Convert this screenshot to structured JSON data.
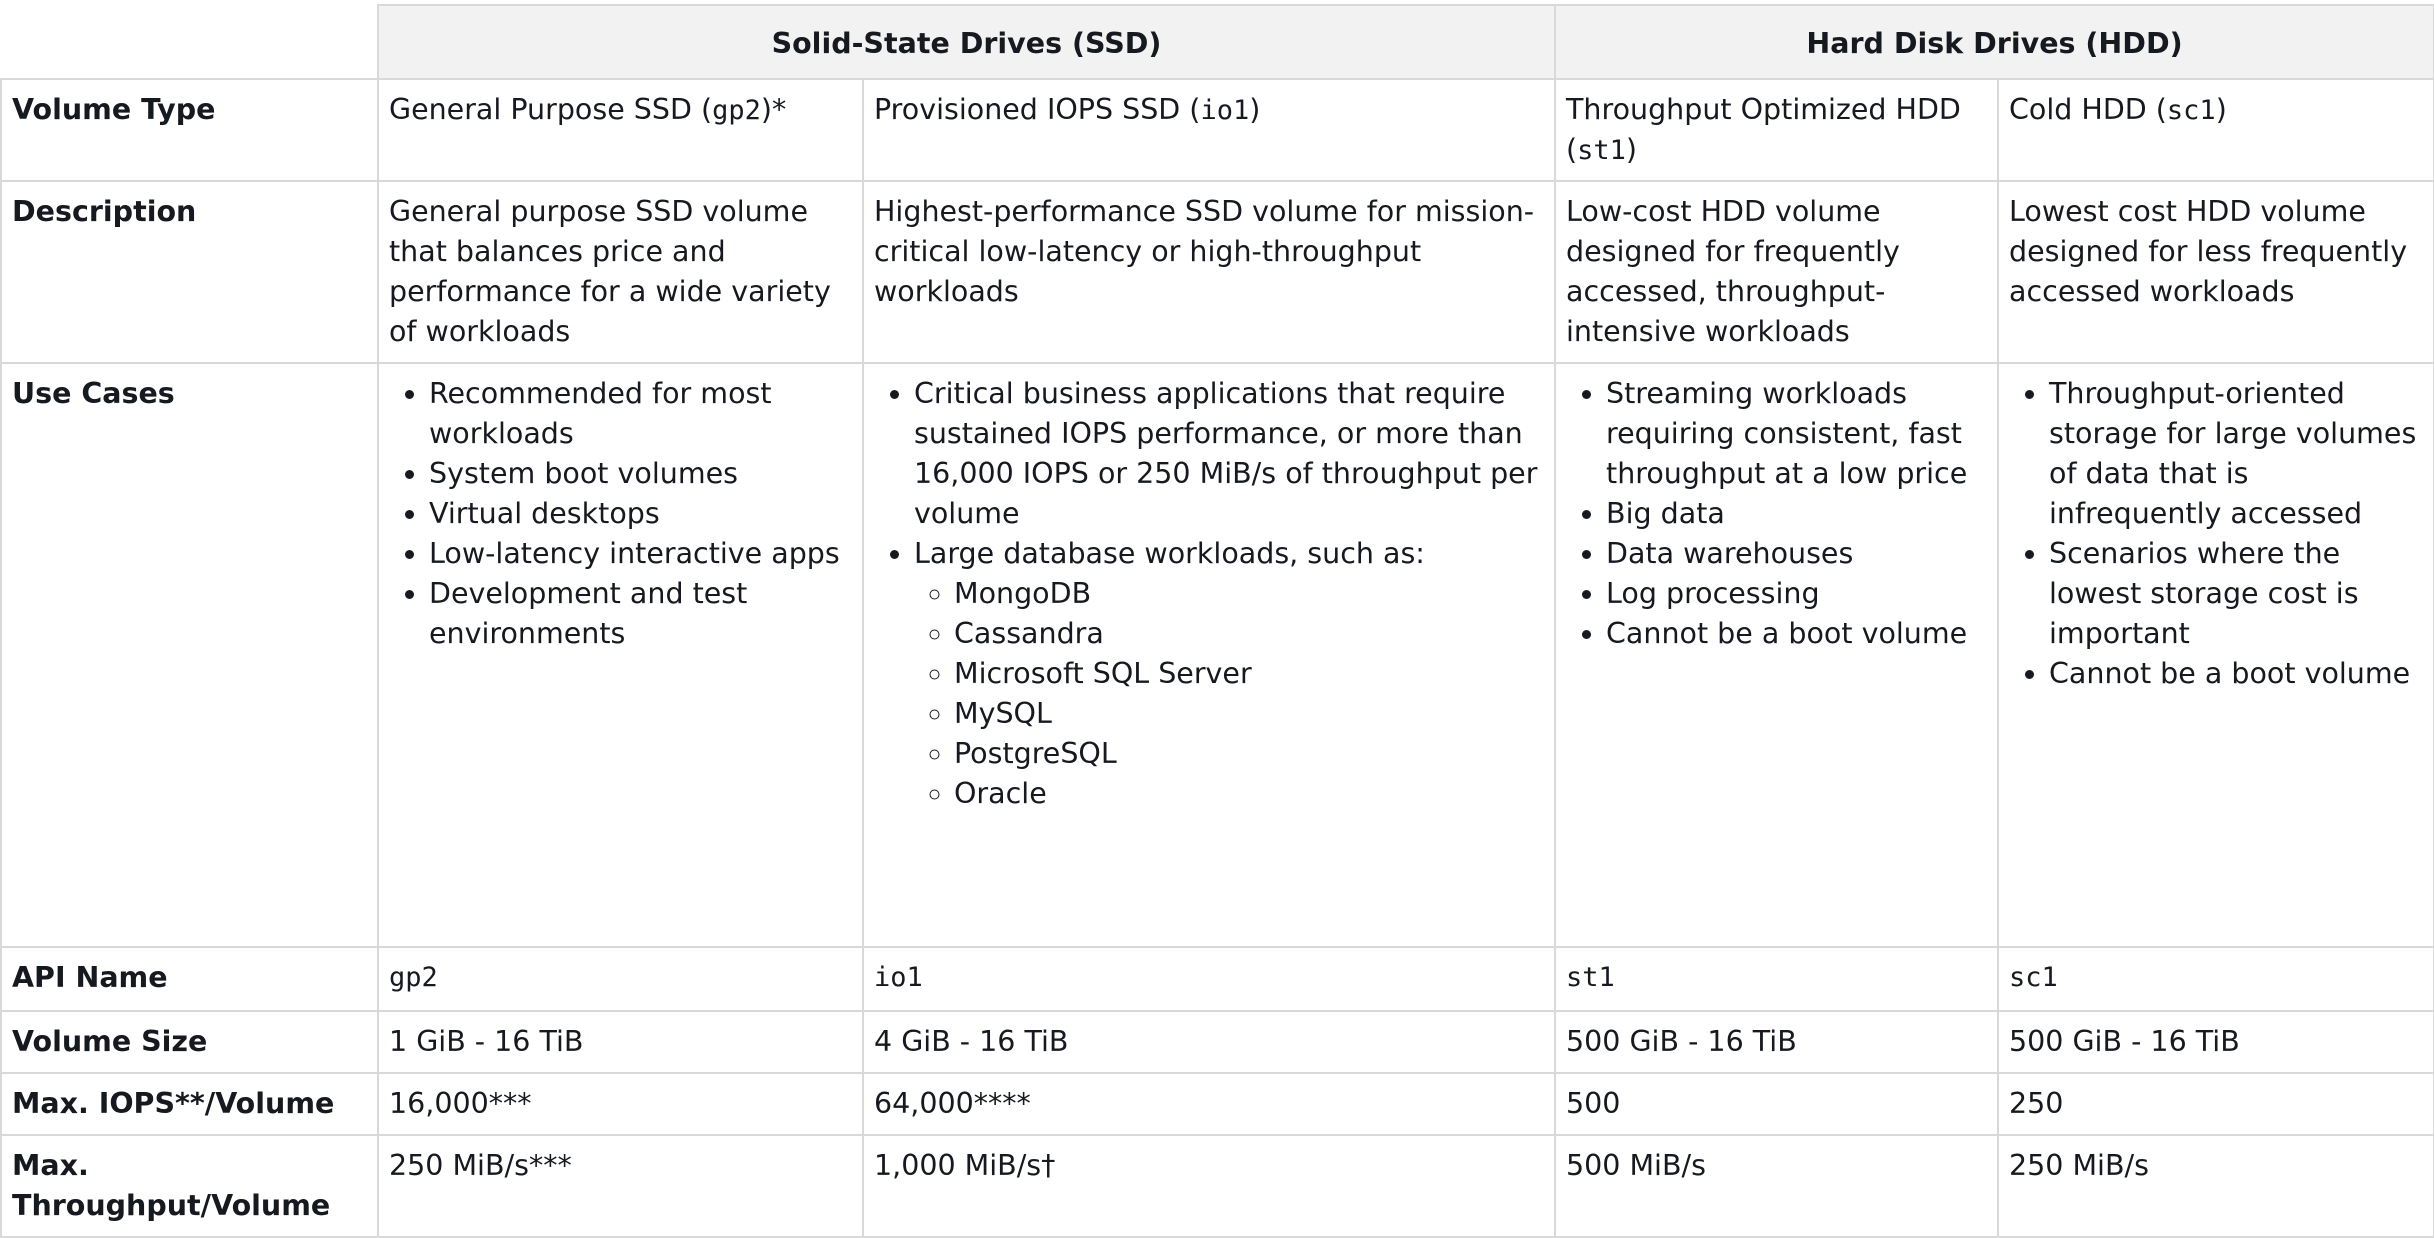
{
  "groups": {
    "ssd": "Solid-State Drives (SSD)",
    "hdd": "Hard Disk Drives (HDD)"
  },
  "row_labels": {
    "volume_type": "Volume Type",
    "description": "Description",
    "use_cases": "Use Cases",
    "api_name": "API Name",
    "volume_size": "Volume Size",
    "max_iops": "Max. IOPS**/Volume",
    "max_throughput_line1": "Max.",
    "max_throughput_line2": "Throughput/Volume"
  },
  "volumes": [
    {
      "type_prefix": "General Purpose SSD (",
      "type_code": "gp2",
      "type_suffix": ")*",
      "description": "General purpose SSD volume that balances price and performance for a wide variety of workloads",
      "use_cases": [
        "Recommended for most workloads",
        "System boot volumes",
        "Virtual desktops",
        "Low-latency interactive apps",
        "Development and test environments"
      ],
      "api_name": "gp2",
      "size": "1 GiB - 16 TiB",
      "max_iops": "16,000***",
      "max_throughput": "250 MiB/s***"
    },
    {
      "type_prefix": "Provisioned IOPS SSD (",
      "type_code": "io1",
      "type_suffix": ")",
      "description": "Highest-performance SSD volume for mission-critical low-latency or high-throughput workloads",
      "use_cases": [
        "Critical business applications that require sustained IOPS performance, or more than 16,000 IOPS or 250 MiB/s of throughput per volume",
        "Large database workloads, such as:"
      ],
      "use_case_sub": [
        "MongoDB",
        "Cassandra",
        "Microsoft SQL Server",
        "MySQL",
        "PostgreSQL",
        "Oracle"
      ],
      "api_name": "io1",
      "size": "4 GiB - 16 TiB",
      "max_iops": "64,000****",
      "max_throughput": "1,000 MiB/s†"
    },
    {
      "type_prefix": "Throughput Optimized HDD (",
      "type_code": "st1",
      "type_suffix": ")",
      "description": "Low-cost HDD volume designed for frequently accessed, throughput-intensive workloads",
      "use_cases": [
        "Streaming workloads requiring consistent, fast throughput at a low price",
        "Big data",
        "Data warehouses",
        "Log processing",
        "Cannot be a boot volume"
      ],
      "api_name": "st1",
      "size": "500 GiB - 16 TiB",
      "max_iops": "500",
      "max_throughput": "500 MiB/s"
    },
    {
      "type_prefix": "Cold HDD (",
      "type_code": "sc1",
      "type_suffix": ")",
      "description": "Lowest cost HDD volume designed for less frequently accessed workloads",
      "use_cases": [
        "Throughput-oriented storage for large volumes of data that is infrequently accessed",
        "Scenarios where the lowest storage cost is important",
        "Cannot be a boot volume"
      ],
      "api_name": "sc1",
      "size": "500 GiB - 16 TiB",
      "max_iops": "250",
      "max_throughput": "250 MiB/s"
    }
  ]
}
